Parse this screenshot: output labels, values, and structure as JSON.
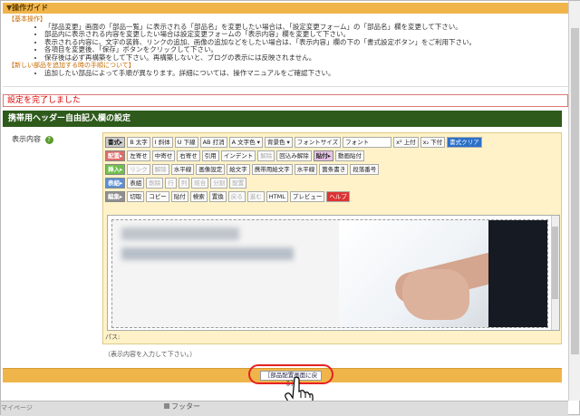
{
  "guide": {
    "title": "▼操作ガイド",
    "basic_head": "【基本操作】",
    "basic_items": [
      "「部品変更」画面の「部品一覧」に表示される「部品名」を変更したい場合は、「設定変更フォーム」の「部品名」欄を変更して下さい。",
      "部品内に表示される内容を変更したい場合は設定変更フォームの「表示内容」欄を変更して下さい。",
      "表示される内容に、文字の装飾、リンクの追加、画像の追加などをしたい場合は、「表示内容」欄の下の「書式設定ボタン」をご利用下さい。",
      "各項目を変更後、「保存」ボタンをクリックして下さい。",
      "保存後は必ず再構築をして下さい。再構築しないと、ブログの表示には反映されません。"
    ],
    "new_head": "【新しい部品を追加する時の手順について】",
    "new_items": [
      "追加したい部品によって手順が異なります。詳細については、操作マニュアルをご確認下さい。"
    ]
  },
  "status": "設定を完了しました",
  "section_title": "携帯用ヘッダー自由記入欄の設定",
  "field_label": "表示内容",
  "toolbar": {
    "row1": [
      "書式▸",
      "B 太字",
      "I 斜体",
      "U 下線",
      "AB 打消",
      "A 文字色 ▾",
      "背景色 ▾",
      "フォントサイズ",
      "フォント",
      "x² 上付",
      "x₂ 下付",
      "書式クリア"
    ],
    "row2": [
      "配置▸",
      "左寄せ",
      "中寄せ",
      "右寄せ",
      "引用",
      "インデント",
      "解除",
      "回込み解除",
      "貼付▸",
      "動画貼付"
    ],
    "row3": [
      "挿入▸",
      "リンク",
      "解除",
      "水平線",
      "画像設定",
      "絵文字",
      "携帯用絵文字",
      "水平線",
      "箇条書き",
      "段落番号"
    ],
    "row4": [
      "表組▸",
      "表組",
      "削除",
      "行",
      "列",
      "結合",
      "分割",
      "配置"
    ],
    "row5": [
      "編集▸",
      "切取",
      "コピー",
      "貼付",
      "検索",
      "置換",
      "戻る",
      "進む",
      "HTML",
      "プレビュー",
      "ヘルプ"
    ]
  },
  "path_label": "パス:",
  "hint": "（表示内容を入力して下さい。）",
  "back_button": "［部品配置画面に戻る］",
  "bottom_left": "マイページ",
  "footer_label": "フッター"
}
